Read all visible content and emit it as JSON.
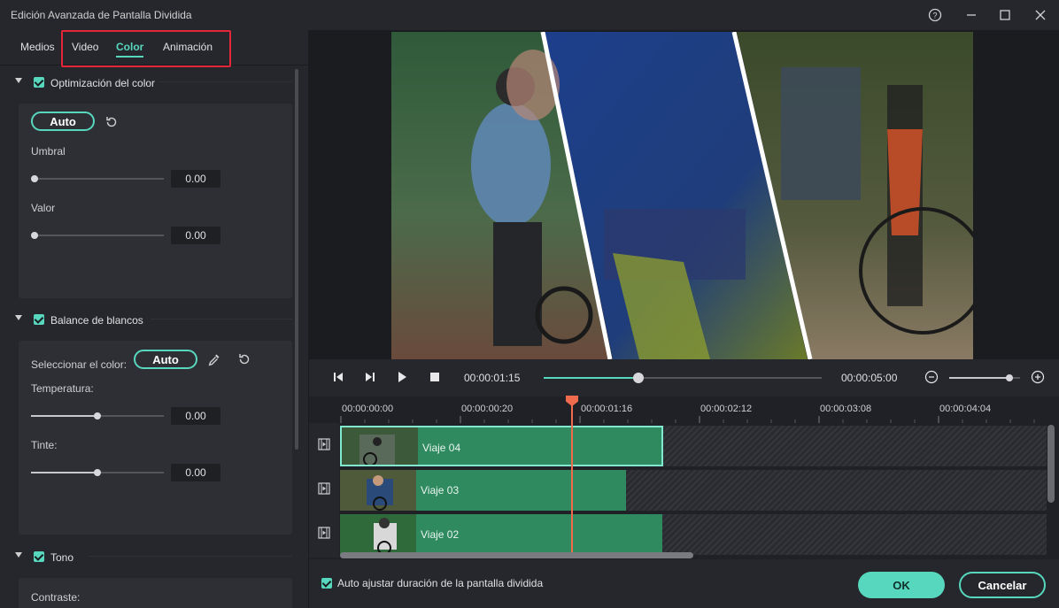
{
  "window": {
    "title": "Edición Avanzada de Pantalla Dividida"
  },
  "tabs": [
    "Medios",
    "Video",
    "Color",
    "Animación"
  ],
  "active_tab": "Color",
  "sections": {
    "color_opt": {
      "label": "Optimización del color",
      "auto_label": "Auto",
      "umbral_label": "Umbral",
      "umbral_value": "0.00",
      "valor_label": "Valor",
      "valor_value": "0.00"
    },
    "white_balance": {
      "label": "Balance de blancos",
      "select_color_label": "Seleccionar el color:",
      "auto_label": "Auto",
      "temp_label": "Temperatura:",
      "temp_value": "0.00",
      "tint_label": "Tinte:",
      "tint_value": "0.00"
    },
    "tone": {
      "label": "Tono",
      "contrast_label": "Contraste:"
    }
  },
  "player": {
    "current_time": "00:00:01:15",
    "total_time": "00:00:05:00",
    "progress": 0.34,
    "zoom_level": 0.85
  },
  "timeline": {
    "ruler": [
      "00:00:00:00",
      "00:00:00:20",
      "00:00:01:16",
      "00:00:02:12",
      "00:00:03:08",
      "00:00:04:04"
    ],
    "tracks": [
      {
        "name": "Viaje 04"
      },
      {
        "name": "Viaje 03"
      },
      {
        "name": "Viaje 02"
      }
    ]
  },
  "footer": {
    "auto_adjust_label": "Auto ajustar duración de la pantalla dividida",
    "ok_label": "OK",
    "cancel_label": "Cancelar"
  },
  "colors": {
    "accent": "#57d7bd",
    "clip": "#2f8a5f",
    "playhead": "#f06a4e",
    "highlight": "#e4263a"
  }
}
